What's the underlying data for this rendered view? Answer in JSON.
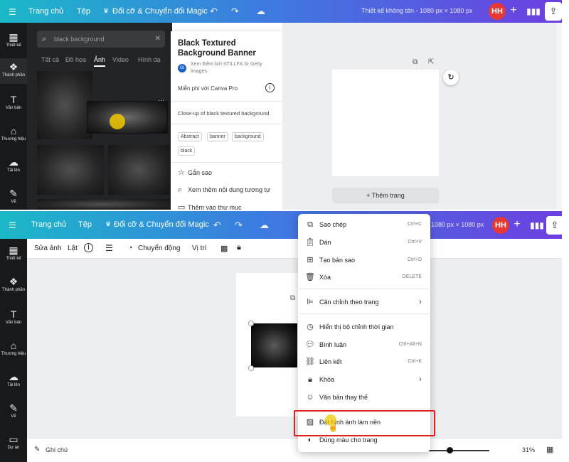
{
  "top": {
    "nav": {
      "home": "Trang chủ",
      "file": "Tệp",
      "resize": "Đổi cỡ & Chuyển đổi Magic",
      "design_title": "Thiết kế không tên - 1080 px × 1080 px",
      "avatar": "HH"
    },
    "sidebar": [
      {
        "label": "Thiết kế",
        "icon": "layout-icon"
      },
      {
        "label": "Thành phần",
        "icon": "elements-icon"
      },
      {
        "label": "Văn bản",
        "icon": "text-icon"
      },
      {
        "label": "Thương hiệu",
        "icon": "brand-icon"
      },
      {
        "label": "Tải lên",
        "icon": "upload-icon"
      },
      {
        "label": "Vẽ",
        "icon": "draw-icon"
      }
    ],
    "search": {
      "value": "black background",
      "tabs": [
        "Tất cả",
        "Đồ họa",
        "Ảnh",
        "Video",
        "Hình dạ"
      ],
      "selected_tab": "Ảnh"
    },
    "info_card": {
      "title": "Black Textured Background Banner",
      "badge": "GI",
      "attribution": "Xem thêm bởi STILLFX từ Getty Images",
      "license": "Miễn phí với Canva Pro",
      "description": "Close-up of black textured background",
      "tags": [
        "Abstract",
        "banner",
        "background",
        "black"
      ],
      "actions": [
        "Gắn sao",
        "Xem thêm nội dung tương tự",
        "Thêm vào thư mục"
      ]
    },
    "add_page": "+ Thêm trang"
  },
  "bottom": {
    "nav": {
      "home": "Trang chủ",
      "file": "Tệp",
      "resize": "Đổi cỡ & Chuyển đổi Magic",
      "design_title": "1080 px × 1080 px",
      "avatar": "HH"
    },
    "sidebar": [
      {
        "label": "Thiết kế",
        "icon": "layout-icon"
      },
      {
        "label": "Thành phần",
        "icon": "elements-icon"
      },
      {
        "label": "Văn bản",
        "icon": "text-icon"
      },
      {
        "label": "Thương hiệu",
        "icon": "brand-icon"
      },
      {
        "label": "Tải lên",
        "icon": "upload-icon"
      },
      {
        "label": "Vẽ",
        "icon": "draw-icon"
      },
      {
        "label": "Dự án",
        "icon": "folder-icon"
      }
    ],
    "toolbar": {
      "edit_image": "Sửa ảnh",
      "flip": "Lật",
      "animate": "Chuyển động",
      "position": "Vị trí"
    },
    "footer": {
      "notes": "Ghi chú",
      "zoom": "31%"
    },
    "context_menu": [
      {
        "label": "Sao chép",
        "shortcut": "Ctrl+C",
        "icon": "copy-icon"
      },
      {
        "label": "Dán",
        "shortcut": "Ctrl+V",
        "icon": "paste-icon"
      },
      {
        "label": "Tạo bản sao",
        "shortcut": "Ctrl+D",
        "icon": "duplicate-icon"
      },
      {
        "label": "Xóa",
        "shortcut": "DELETE",
        "icon": "trash-icon"
      },
      {
        "label": "Căn chỉnh theo trang",
        "shortcut": "",
        "icon": "align-icon"
      },
      {
        "label": "Hiển thị bộ chỉnh thời gian",
        "shortcut": "",
        "icon": "timer-icon"
      },
      {
        "label": "Bình luận",
        "shortcut": "Ctrl+Alt+N",
        "icon": "comment-icon"
      },
      {
        "label": "Liên kết",
        "shortcut": "Ctrl+K",
        "icon": "link-icon"
      },
      {
        "label": "Khóa",
        "shortcut": "",
        "icon": "lock-icon"
      },
      {
        "label": "Văn bản thay thế",
        "shortcut": "",
        "icon": "accessibility-icon"
      },
      {
        "label": "Đặt hình ảnh làm nền",
        "shortcut": "",
        "icon": "set-background-icon"
      },
      {
        "label": "Dùng màu cho trang",
        "shortcut": "",
        "icon": "palette-icon"
      }
    ]
  }
}
